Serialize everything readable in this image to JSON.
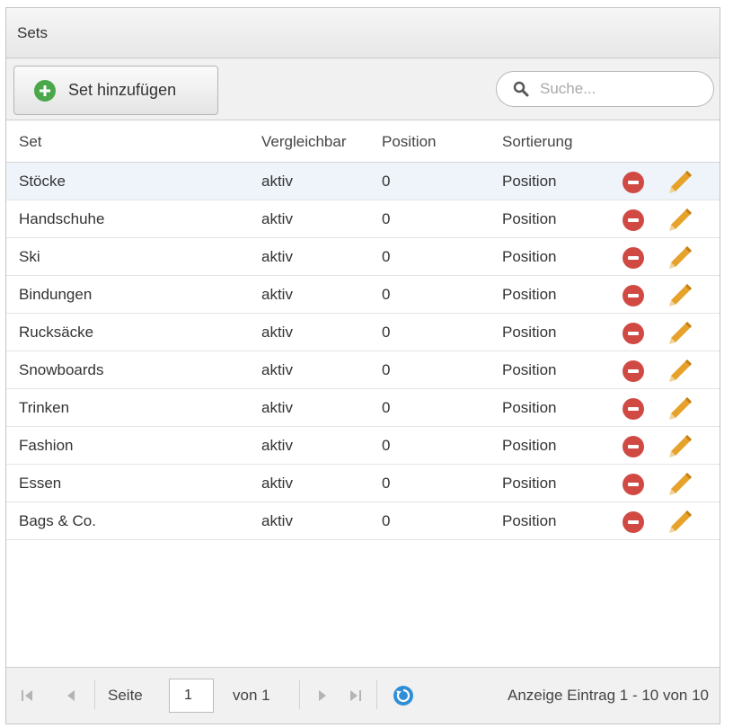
{
  "panel": {
    "title": "Sets"
  },
  "toolbar": {
    "add_label": "Set hinzufügen",
    "search_placeholder": "Suche..."
  },
  "columns": {
    "set": "Set",
    "vergleichbar": "Vergleichbar",
    "position": "Position",
    "sortierung": "Sortierung"
  },
  "rows": [
    {
      "set": "Stöcke",
      "vergleichbar": "aktiv",
      "position": "0",
      "sortierung": "Position"
    },
    {
      "set": "Handschuhe",
      "vergleichbar": "aktiv",
      "position": "0",
      "sortierung": "Position"
    },
    {
      "set": "Ski",
      "vergleichbar": "aktiv",
      "position": "0",
      "sortierung": "Position"
    },
    {
      "set": "Bindungen",
      "vergleichbar": "aktiv",
      "position": "0",
      "sortierung": "Position"
    },
    {
      "set": "Rucksäcke",
      "vergleichbar": "aktiv",
      "position": "0",
      "sortierung": "Position"
    },
    {
      "set": "Snowboards",
      "vergleichbar": "aktiv",
      "position": "0",
      "sortierung": "Position"
    },
    {
      "set": "Trinken",
      "vergleichbar": "aktiv",
      "position": "0",
      "sortierung": "Position"
    },
    {
      "set": "Fashion",
      "vergleichbar": "aktiv",
      "position": "0",
      "sortierung": "Position"
    },
    {
      "set": "Essen",
      "vergleichbar": "aktiv",
      "position": "0",
      "sortierung": "Position"
    },
    {
      "set": "Bags & Co.",
      "vergleichbar": "aktiv",
      "position": "0",
      "sortierung": "Position"
    }
  ],
  "pager": {
    "page_label": "Seite",
    "page_value": "1",
    "of_label": "von 1",
    "info": "Anzeige Eintrag 1 - 10 von 10"
  },
  "icons": {
    "add": "plus-circle-icon",
    "search": "magnifier-icon",
    "delete": "minus-circle-icon",
    "edit": "pencil-icon",
    "first": "first-page-icon",
    "prev": "prev-page-icon",
    "next": "next-page-icon",
    "last": "last-page-icon",
    "refresh": "refresh-icon"
  },
  "colors": {
    "add_icon": "#4aa84b",
    "delete_icon": "#d04a43",
    "edit_icon": "#e6a22a",
    "refresh_icon": "#2f8fd6",
    "selected_row": "#eef4fa"
  }
}
